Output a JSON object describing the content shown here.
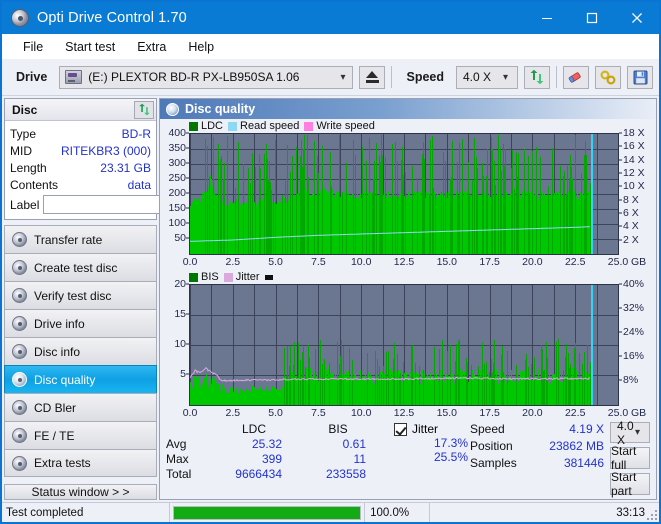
{
  "window": {
    "title": "Opti Drive Control 1.70",
    "icon": "disc-icon",
    "minimize": "minimize-icon",
    "maximize": "maximize-icon",
    "close": "close-icon"
  },
  "menu": {
    "items": [
      "File",
      "Start test",
      "Extra",
      "Help"
    ]
  },
  "toolbar": {
    "drive_label": "Drive",
    "drive_value": "(E:)   PLEXTOR BD-R  PX-LB950SA 1.06",
    "eject_icon": "eject-icon",
    "speed_label": "Speed",
    "speed_value": "4.0 X",
    "refresh_icon": "refresh-icon",
    "erase_icon": "eraser-icon",
    "tools_icon": "tools-icon",
    "save_icon": "save-icon"
  },
  "disc_panel": {
    "title": "Disc",
    "refresh_icon": "refresh-icon",
    "rows": [
      {
        "key": "Type",
        "value": "BD-R"
      },
      {
        "key": "MID",
        "value": "RITEKBR3 (000)"
      },
      {
        "key": "Length",
        "value": "23.31 GB"
      },
      {
        "key": "Contents",
        "value": "data"
      }
    ],
    "label_key": "Label",
    "label_value": "",
    "label_placeholder": "",
    "disc_button_icon": "cd-icon"
  },
  "sidebar": {
    "items": [
      {
        "label": "Transfer rate",
        "active": false
      },
      {
        "label": "Create test disc",
        "active": false
      },
      {
        "label": "Verify test disc",
        "active": false
      },
      {
        "label": "Drive info",
        "active": false
      },
      {
        "label": "Disc info",
        "active": false
      },
      {
        "label": "Disc quality",
        "active": true
      },
      {
        "label": "CD Bler",
        "active": false
      },
      {
        "label": "FE / TE",
        "active": false
      },
      {
        "label": "Extra tests",
        "active": false
      }
    ],
    "status_button": "Status window > >"
  },
  "main": {
    "header_title": "Disc quality",
    "header_icon": "disc-quality-icon"
  },
  "chart_data": [
    {
      "type": "area",
      "title": "LDC / Read speed",
      "xlabel": "GB",
      "ylabel": "LDC",
      "legend": [
        {
          "name": "LDC",
          "color": "#007800"
        },
        {
          "name": "Read speed",
          "color": "#8fd8f5"
        },
        {
          "name": "Write speed",
          "color": "#ff7fe0"
        }
      ],
      "legend_position": "top-left",
      "grid": true,
      "xlim": [
        0.0,
        25.0
      ],
      "xticks": [
        0.0,
        2.5,
        5.0,
        7.5,
        10.0,
        12.5,
        15.0,
        17.5,
        20.0,
        22.5,
        25.0
      ],
      "xtick_labels": [
        "0.0",
        "2.5",
        "5.0",
        "7.5",
        "10.0",
        "12.5",
        "15.0",
        "17.5",
        "20.0",
        "22.5",
        "25.0"
      ],
      "x_unit": "GB",
      "ylim": [
        0,
        400
      ],
      "yticks": [
        50,
        100,
        150,
        200,
        250,
        300,
        350,
        400
      ],
      "y2lim": [
        0,
        18
      ],
      "y2ticks": [
        2,
        4,
        6,
        8,
        10,
        12,
        14,
        16,
        18
      ],
      "y2tick_labels": [
        "2 X",
        "4 X",
        "6 X",
        "8 X",
        "10 X",
        "12 X",
        "14 X",
        "16 X",
        "18 X"
      ],
      "cursor_x": 23.4,
      "data_end_x": 23.4,
      "series": [
        {
          "name": "LDC",
          "color": "#00c800",
          "x": [
            0.0,
            0.3,
            0.6,
            0.9,
            1.2,
            1.5,
            1.8,
            2.1,
            2.4,
            2.7,
            3.0,
            3.3,
            3.6,
            3.9,
            4.2,
            4.5,
            4.8,
            5.1,
            5.4,
            5.7,
            6.0,
            6.3,
            6.6,
            6.9,
            7.2,
            7.5,
            7.8,
            8.1,
            8.4,
            8.7,
            9.0,
            9.3,
            9.6,
            9.9,
            10.2,
            10.5,
            10.8,
            11.1,
            11.4,
            11.7,
            12.0,
            12.6,
            13.2,
            13.8,
            14.4,
            15.0,
            15.6,
            16.2,
            16.8,
            17.4,
            18.0,
            18.6,
            19.2,
            19.8,
            20.4,
            21.0,
            21.6,
            22.2,
            22.8,
            23.4
          ],
          "values": [
            170,
            180,
            185,
            205,
            250,
            190,
            175,
            172,
            165,
            170,
            168,
            172,
            170,
            168,
            170,
            172,
            170,
            168,
            175,
            178,
            185,
            195,
            200,
            198,
            200,
            202,
            205,
            203,
            200,
            201,
            205,
            200,
            198,
            200,
            202,
            198,
            196,
            200,
            198,
            196,
            195,
            197,
            196,
            198,
            197,
            196,
            198,
            197,
            196,
            198,
            197,
            196,
            198,
            196,
            197,
            196,
            195,
            198,
            197,
            196
          ]
        },
        {
          "name": "Read speed",
          "color": "#8fd8f5",
          "x": [
            0.0,
            2.5,
            5.0,
            7.5,
            10.0,
            12.5,
            15.0,
            17.5,
            20.0,
            22.5,
            23.4
          ],
          "values": [
            1.9,
            2.1,
            2.5,
            2.8,
            3.0,
            3.2,
            3.4,
            3.6,
            3.8,
            4.0,
            4.1
          ]
        }
      ],
      "spike_max": 399
    },
    {
      "type": "area",
      "title": "BIS / Jitter",
      "xlabel": "GB",
      "ylabel": "BIS",
      "legend": [
        {
          "name": "BIS",
          "color": "#007800"
        },
        {
          "name": "Jitter",
          "color": "#d9a8dd"
        }
      ],
      "legend_position": "top-left",
      "grid": true,
      "xlim": [
        0.0,
        25.0
      ],
      "xticks": [
        0.0,
        2.5,
        5.0,
        7.5,
        10.0,
        12.5,
        15.0,
        17.5,
        20.0,
        22.5,
        25.0
      ],
      "xtick_labels": [
        "0.0",
        "2.5",
        "5.0",
        "7.5",
        "10.0",
        "12.5",
        "15.0",
        "17.5",
        "20.0",
        "22.5",
        "25.0"
      ],
      "x_unit": "GB",
      "ylim": [
        0,
        20
      ],
      "yticks": [
        5,
        10,
        15,
        20
      ],
      "y2lim": [
        0,
        40
      ],
      "y2ticks": [
        8,
        16,
        24,
        32,
        40
      ],
      "y2tick_labels": [
        "8%",
        "16%",
        "24%",
        "32%",
        "40%"
      ],
      "cursor_x": 23.4,
      "data_end_x": 23.4,
      "series": [
        {
          "name": "BIS",
          "color": "#00c800",
          "x": [
            0.0,
            0.5,
            1.0,
            1.5,
            2.0,
            2.5,
            3.0,
            3.5,
            4.0,
            4.5,
            5.0,
            5.5,
            6.0,
            6.5,
            7.0,
            7.5,
            8.0,
            8.5,
            9.0,
            9.5,
            10.0,
            10.5,
            11.0,
            11.5,
            12.0,
            12.5,
            13.0,
            13.5,
            14.0,
            14.5,
            15.0,
            15.5,
            16.0,
            16.5,
            17.0,
            17.5,
            18.0,
            18.5,
            19.0,
            19.5,
            20.0,
            20.5,
            21.0,
            21.5,
            22.0,
            22.5,
            23.0,
            23.4
          ],
          "values": [
            3.8,
            4.2,
            4.0,
            3.6,
            2.6,
            2.4,
            2.5,
            2.6,
            2.5,
            2.6,
            2.5,
            2.6,
            4.6,
            4.8,
            4.9,
            5.0,
            5.2,
            5.4,
            5.2,
            4.8,
            4.6,
            4.7,
            4.6,
            4.8,
            4.7,
            4.8,
            4.7,
            4.8,
            4.7,
            4.8,
            4.7,
            4.8,
            4.9,
            4.8,
            4.7,
            4.8,
            4.7,
            4.8,
            4.9,
            4.8,
            4.7,
            4.8,
            4.7,
            4.9,
            5.0,
            4.8,
            4.7,
            4.6
          ]
        },
        {
          "name": "Jitter",
          "color": "#d9a8dd",
          "x": [
            0.0,
            0.3,
            0.6,
            0.9,
            1.2,
            1.5,
            1.8,
            2.1,
            2.5,
            3.0,
            3.5,
            4.0,
            4.5,
            5.0,
            5.5,
            6.0,
            6.5,
            7.0,
            7.5,
            8.0,
            8.5,
            9.0,
            9.5,
            10.0,
            11.0,
            12.0,
            13.0,
            14.0,
            15.0,
            16.0,
            17.0,
            18.0,
            19.0,
            20.0,
            21.0,
            22.0,
            23.0,
            23.4
          ],
          "values": [
            9.0,
            11.5,
            10.5,
            12.4,
            11.0,
            10.2,
            8.3,
            8.1,
            8.2,
            8.3,
            8.3,
            8.4,
            8.3,
            8.4,
            8.5,
            8.6,
            8.5,
            8.6,
            8.7,
            8.6,
            8.7,
            8.7,
            8.6,
            8.7,
            8.7,
            8.6,
            8.7,
            8.8,
            8.9,
            9.0,
            8.9,
            8.8,
            8.7,
            8.8,
            8.7,
            8.8,
            8.7,
            8.8
          ]
        }
      ]
    }
  ],
  "stats": {
    "headers": [
      "",
      "LDC",
      "BIS"
    ],
    "rows": [
      {
        "key": "Avg",
        "ldc": "25.32",
        "bis": "0.61"
      },
      {
        "key": "Max",
        "ldc": "399",
        "bis": "11"
      },
      {
        "key": "Total",
        "ldc": "9666434",
        "bis": "233558"
      }
    ],
    "jitter": {
      "label": "Jitter",
      "checked": true,
      "avg": "17.3%",
      "max": "25.5%"
    },
    "info": [
      {
        "key": "Speed",
        "value": "4.19 X"
      },
      {
        "key": "Position",
        "value": "23862 MB"
      },
      {
        "key": "Samples",
        "value": "381446"
      }
    ],
    "speed_select": "4.0 X",
    "start_full": "Start full",
    "start_part": "Start part"
  },
  "statusbar": {
    "text": "Test completed",
    "progress_pct": "100.0%",
    "progress_value": 100,
    "time": "33:13"
  },
  "colors": {
    "accent": "#0a7bd4",
    "ldc_green": "#00c800",
    "plot_bg": "#6b7791",
    "jitter": "#d9a8dd",
    "read_speed": "#8fd8f5",
    "value_blue": "#2233cc"
  }
}
